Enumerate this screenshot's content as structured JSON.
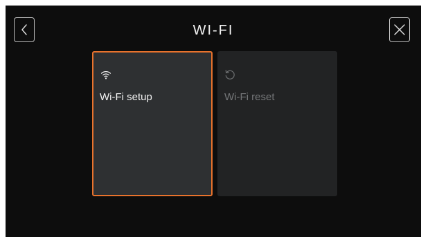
{
  "header": {
    "title": "WI-FI",
    "back_icon": "chevron-left-icon",
    "close_icon": "close-icon"
  },
  "cards": [
    {
      "label": "Wi-Fi setup",
      "icon": "wifi-icon",
      "state": "selected"
    },
    {
      "label": "Wi-Fi reset",
      "icon": "reset-icon",
      "state": "disabled"
    }
  ],
  "colors": {
    "background": "#0d0d0d",
    "card_selected_bg": "#2e3032",
    "card_disabled_bg": "#222324",
    "accent": "#e8722c",
    "text": "#f5f5f5",
    "text_disabled": "#77797b"
  }
}
